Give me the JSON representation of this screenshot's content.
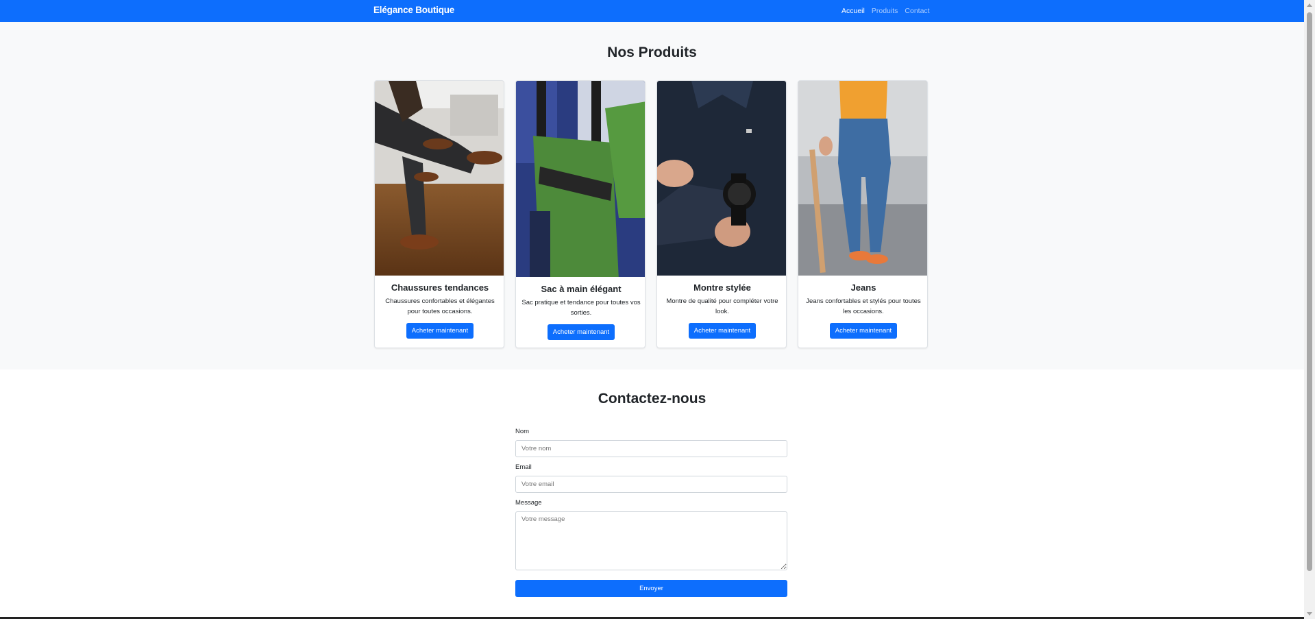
{
  "navbar": {
    "brand": "Elégance Boutique",
    "links": [
      "Accueil",
      "Produits",
      "Contact"
    ],
    "active": "Accueil"
  },
  "products": {
    "title": "Nos Produits",
    "items": [
      {
        "title": "Chaussures tendances",
        "text": "Chaussures confortables et élégantes pour toutes occasions.",
        "button": "Acheter maintenant",
        "image": "shoes-photo"
      },
      {
        "title": "Sac à main élégant",
        "text": "Sac pratique et tendance pour toutes vos sorties.",
        "button": "Acheter maintenant",
        "image": "bag-photo"
      },
      {
        "title": "Montre stylée",
        "text": "Montre de qualité pour compléter votre look.",
        "button": "Acheter maintenant",
        "image": "watch-photo"
      },
      {
        "title": "Jeans",
        "text": "Jeans confortables et stylés pour toutes les occasions.",
        "button": "Acheter maintenant",
        "image": "jeans-photo"
      }
    ]
  },
  "contact": {
    "title": "Contactez-nous",
    "name_label": "Nom",
    "name_placeholder": "Votre nom",
    "email_label": "Email",
    "email_placeholder": "Votre email",
    "message_label": "Message",
    "message_placeholder": "Votre message",
    "submit": "Envoyer"
  },
  "colors": {
    "primary": "#0d6efd",
    "section_bg": "#f8f9fa"
  }
}
